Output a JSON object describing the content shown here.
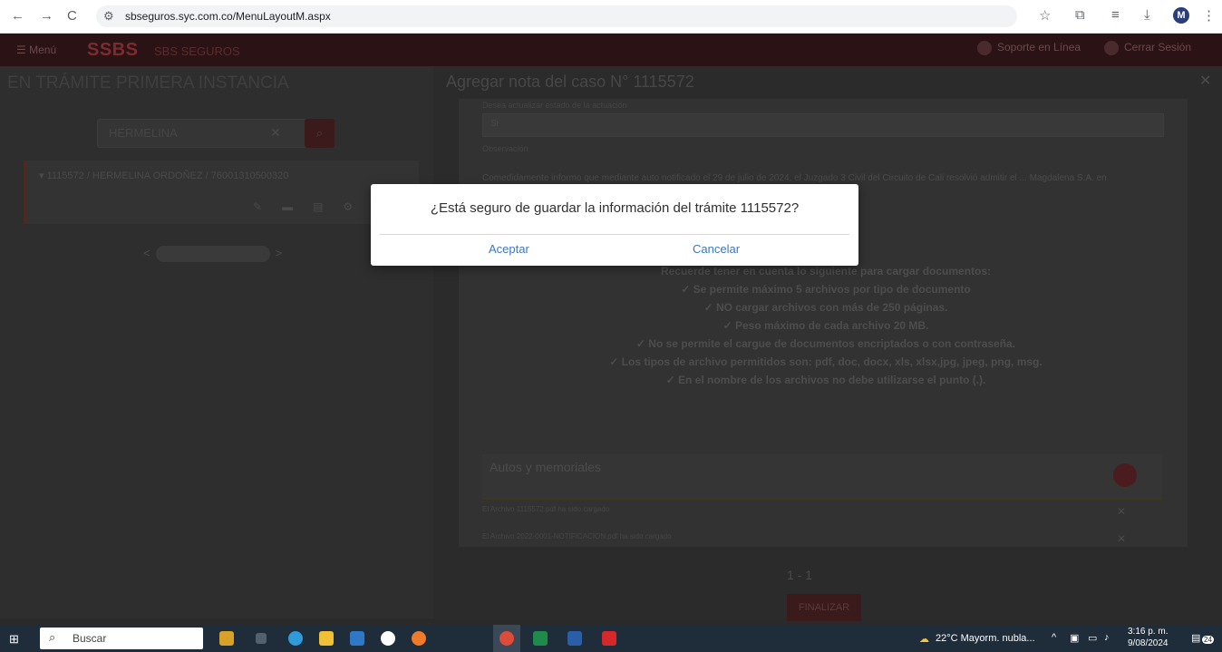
{
  "browser": {
    "back_icon": "←",
    "forward_icon": "→",
    "reload_icon": "C",
    "url": "sbseguros.syc.com.co/MenuLayoutM.aspx",
    "profile_initial": "M"
  },
  "app_header": {
    "menu_label": "Menú",
    "logo_text": "SSBS",
    "logo_sub": "SBS SEGUROS",
    "help_label": "Soporte en Línea",
    "user_label": "Cerrar Sesión"
  },
  "left_panel": {
    "title": "EN TRÁMITE PRIMERA INSTANCIA",
    "search_value": "HERMELINA",
    "case_text": "▾ 1115572 / HERMELINA ORDOÑEZ / 76001310500320",
    "pager_prev": "<",
    "pager_next": ">"
  },
  "right_panel": {
    "title": "Agregar nota del caso N° 1115572",
    "field1_label": "Desea actualizar estado de la actuación",
    "field1_value": "Si",
    "field2_label": "Observación",
    "observation_text": "Comedidamente informo que mediante auto notificado el 29 de julio de 2024, el Juzgado 3 Civil del Circuito de Cali resolvió admitir el ... Magdalena S.A. en atención a los hechos de la demanda",
    "requirements": [
      "Recuerde tener en cuenta lo siguiente para cargar documentos:",
      "✓ Se permite máximo 5 archivos por tipo de documento",
      "✓ NO cargar archivos con más de 250 páginas.",
      "✓ Peso máximo de cada archivo 20 MB.",
      "✓ No se permite el cargue de documentos encriptados o con contraseña.",
      "✓ Los tipos de archivo permitidos son: pdf, doc, docx, xls, xlsx,jpg, jpeg, png, msg.",
      "✓ En el nombre de los archivos no debe utilizarse el punto (.)."
    ],
    "autos_title": "Autos y memoriales",
    "files": [
      "El Archivo 1115572.pdf ha sido cargado",
      "El Archivo 2022-0001-NOTIFICACION.pdf ha sido cargado"
    ],
    "page_indicator": "1 - 1",
    "finalize_label": "FINALIZAR"
  },
  "modal": {
    "message": "¿Está seguro de guardar la información del trámite 1115572?",
    "accept_label": "Aceptar",
    "cancel_label": "Cancelar"
  },
  "taskbar": {
    "search_placeholder": "Buscar",
    "weather": "22°C Mayorm. nubla...",
    "time": "3:16 p. m.",
    "date": "9/08/2024",
    "notifications": "24"
  },
  "colors": {
    "accent_red": "#7a2c31",
    "link_blue": "#3b78c3",
    "taskbar": "#1f2c3a"
  }
}
